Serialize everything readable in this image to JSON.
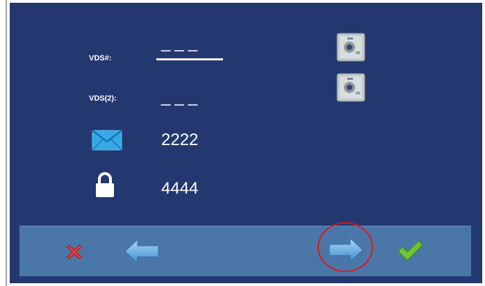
{
  "fields": {
    "vds_label": "VDS#:",
    "vds_value": "___",
    "vds2_label": "VDS(2):",
    "vds2_value": "___",
    "mail_value": "2222",
    "lock_value": "4444"
  },
  "icons": {
    "mail": "envelope-icon",
    "lock": "lock-icon",
    "camera": "door-camera-icon",
    "cancel": "cross-icon",
    "back": "arrow-left-icon",
    "next": "arrow-right-icon",
    "confirm": "checkmark-icon"
  },
  "colors": {
    "background": "#22386f",
    "toolbar": "#4b77a8",
    "focus_ring": "#d8181e",
    "cancel": "#e23b3b",
    "confirm": "#6cc62d"
  }
}
